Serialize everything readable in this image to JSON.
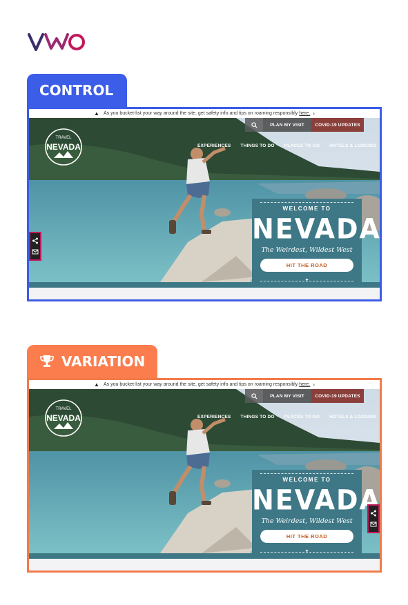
{
  "brand": {
    "logo_name": "VWO",
    "accent": "#3b5de7",
    "variation_color": "#fb7d4e",
    "logo_color": "#7a2a73"
  },
  "panels": [
    {
      "label": "CONTROL",
      "notice": {
        "text": "As you bucket-list your way around the site, get safety info and tips on roaming responsibly",
        "link": "here."
      },
      "nav": {
        "plan": "PLAN MY VISIT",
        "covid": "COVID-19 UPDATES"
      },
      "menu": [
        "EXPERIENCES",
        "THINGS TO DO",
        "PLACES TO GO",
        "HOTELS & LODGING"
      ],
      "logo_text": {
        "top": "TRAVEL",
        "main": "NEVADA"
      },
      "welcome": {
        "line1": "WELCOME TO",
        "line2": "NEVADA",
        "line3": "The Weirdest, Wildest West",
        "cta": "HIT THE ROAD"
      },
      "share_position": "left"
    },
    {
      "label": "VARIATION",
      "notice": {
        "text": "As you bucket-list your way around the site, get safety info and tips on roaming responsibly",
        "link": "here."
      },
      "nav": {
        "plan": "PLAN MY VISIT",
        "covid": "COVID-19 UPDATES"
      },
      "menu": [
        "EXPERIENCES",
        "THINGS TO DO",
        "PLACES TO GO",
        "HOTELS & LODGING"
      ],
      "logo_text": {
        "top": "TRAVEL",
        "main": "NEVADA"
      },
      "welcome": {
        "line1": "WELCOME TO",
        "line2": "NEVADA",
        "line3": "The Weirdest, Wildest West",
        "cta": "HIT THE ROAD"
      },
      "share_position": "right"
    }
  ]
}
